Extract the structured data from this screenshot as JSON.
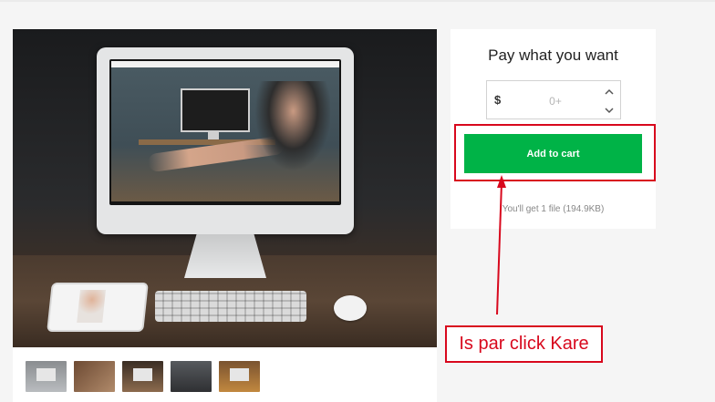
{
  "product": {
    "gallery": {
      "main_image_alt": "iMac on desk with keyboard, mouse and tablet",
      "thumbnails": [
        "imac-front",
        "desk-items",
        "laptop-desk",
        "phone-laptop",
        "laptop-wood"
      ]
    }
  },
  "purchase": {
    "title": "Pay what you want",
    "currency": "$",
    "price_placeholder": "0+",
    "add_to_cart_label": "Add to cart",
    "file_info": "You'll get 1 file (194.9KB)"
  },
  "annotation": {
    "text": "Is par click Kare",
    "color": "#d8081d"
  },
  "colors": {
    "accent": "#00b347",
    "annotation": "#d8081d"
  }
}
